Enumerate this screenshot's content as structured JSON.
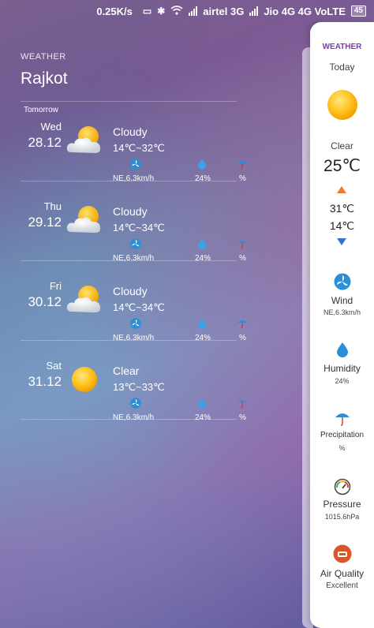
{
  "status_bar": {
    "speed": "0.25K/s",
    "carrier1": "airtel 3G",
    "carrier2": "Jio 4G 4G VoLTE",
    "battery": "45"
  },
  "header": {
    "label": "WEATHER",
    "city": "Rajkot"
  },
  "forecast": {
    "tomorrow_label": "Tomorrow",
    "days": [
      {
        "day": "Wed",
        "date": "28.12",
        "condition": "Cloudy",
        "temp": "14℃~32℃",
        "wind": "NE,6.3km/h",
        "humidity": "24%",
        "precip": "%",
        "icon": "partly-cloudy"
      },
      {
        "day": "Thu",
        "date": "29.12",
        "condition": "Cloudy",
        "temp": "14℃~34℃",
        "wind": "NE,6.3km/h",
        "humidity": "24%",
        "precip": "%",
        "icon": "partly-cloudy"
      },
      {
        "day": "Fri",
        "date": "30.12",
        "condition": "Cloudy",
        "temp": "14℃~34℃",
        "wind": "NE,6.3km/h",
        "humidity": "24%",
        "precip": "%",
        "icon": "partly-cloudy"
      },
      {
        "day": "Sat",
        "date": "31.12",
        "condition": "Clear",
        "temp": "13℃~33℃",
        "wind": "NE,6.3km/h",
        "humidity": "24%",
        "precip": "%",
        "icon": "sun"
      }
    ]
  },
  "panel": {
    "title": "WEATHER",
    "today": "Today",
    "condition": "Clear",
    "temp": "25℃",
    "high": "31℃",
    "low": "14℃",
    "wind_label": "Wind",
    "wind_value": "NE,6.3km/h",
    "humidity_label": "Humidity",
    "humidity_value": "24%",
    "precip_label": "Precipitation",
    "precip_value": "%",
    "pressure_label": "Pressure",
    "pressure_value": "1015.6hPa",
    "aq_label": "Air Quality",
    "aq_value": "Excellent"
  },
  "colors": {
    "accent": "#7a3fa0",
    "up_arrow": "#f07a2a",
    "down_arrow": "#3b6fd8",
    "icon_blue": "#2a8fd6"
  }
}
